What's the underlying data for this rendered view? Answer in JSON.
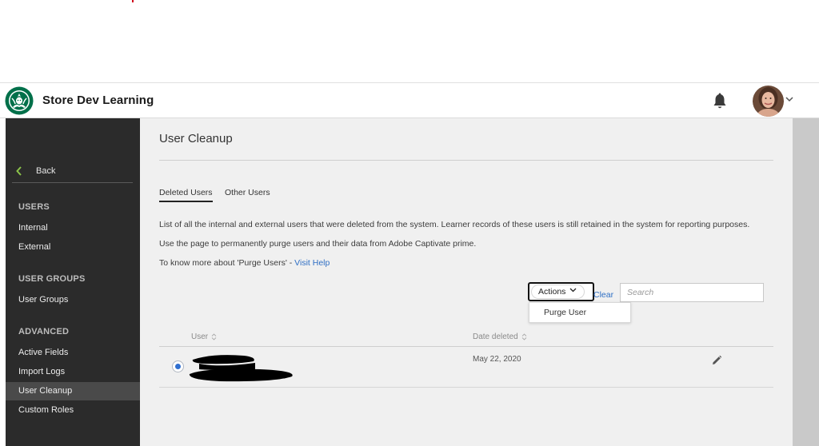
{
  "header": {
    "app_title": "Store Dev Learning"
  },
  "sidebar": {
    "back_label": "Back",
    "sections": [
      {
        "title": "USERS",
        "items": [
          "Internal",
          "External"
        ]
      },
      {
        "title": "USER GROUPS",
        "items": [
          "User Groups"
        ]
      },
      {
        "title": "ADVANCED",
        "items": [
          "Active Fields",
          "Import Logs",
          "User Cleanup",
          "Custom Roles"
        ]
      }
    ],
    "active_item": "User Cleanup"
  },
  "main": {
    "page_title": "User Cleanup",
    "tabs": [
      {
        "label": "Deleted Users",
        "active": true
      },
      {
        "label": "Other Users",
        "active": false
      }
    ],
    "description": [
      "List of all the internal and external users that were deleted from the system. Learner records of these users is still retained in the system for reporting purposes.",
      "Use the page to permanently purge users and their data from Adobe Captivate prime.",
      "To know more about 'Purge Users' - "
    ],
    "help_link": "Visit Help",
    "toolbar": {
      "actions_label": "Actions",
      "clear_label": "Clear",
      "search_placeholder": "Search",
      "dropdown_items": [
        "Purge User"
      ]
    },
    "table": {
      "columns": [
        "User",
        "Date deleted"
      ],
      "rows": [
        {
          "user": "",
          "date_deleted": "May 22, 2020",
          "selected": true
        }
      ]
    }
  },
  "colors": {
    "sidebar_bg": "#2b2b2b",
    "content_bg": "#f0f0f0",
    "link": "#2f6fc4",
    "brand_green": "#00704a",
    "back_chevron": "#8bc34a"
  },
  "icons": [
    "starbucks-logo",
    "bell-icon",
    "avatar",
    "chevron-down-icon",
    "chevron-left-icon",
    "sort-icon",
    "edit-icon"
  ]
}
